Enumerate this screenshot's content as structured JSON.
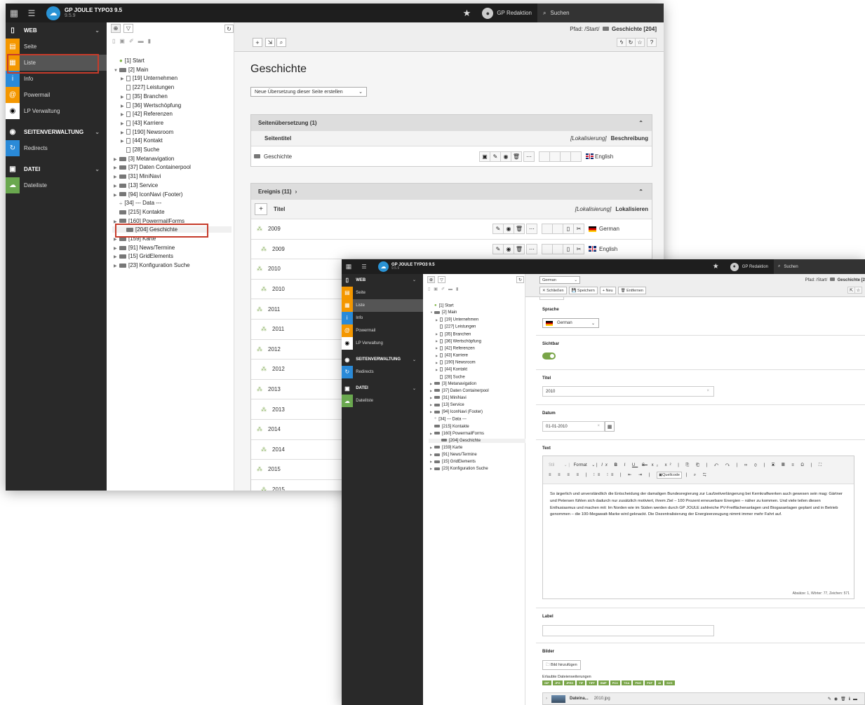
{
  "app": {
    "title": "GP JOULE TYPO3 9.5",
    "version": "9.5.9",
    "user": "GP Redaktion",
    "search": "Suchen"
  },
  "modules": [
    {
      "label": "WEB",
      "type": "group"
    },
    {
      "label": "Seite",
      "color": "#f49700"
    },
    {
      "label": "Liste",
      "color": "#f49700"
    },
    {
      "label": "Info",
      "color": "#2a8ad8"
    },
    {
      "label": "Powermail",
      "color": "#f49700"
    },
    {
      "label": "LP Verwaltung",
      "color": "#ffffff"
    },
    {
      "label": "SEITENVERWALTUNG",
      "type": "group"
    },
    {
      "label": "Redirects",
      "color": "#2a8ad8"
    },
    {
      "label": "DATEI",
      "type": "group"
    },
    {
      "label": "Dateiliste",
      "color": "#6aa84f"
    }
  ],
  "tree": [
    {
      "label": "[1] Start",
      "depth": 0
    },
    {
      "label": "[2] Main",
      "depth": 0
    },
    {
      "label": "[19] Unternehmen",
      "depth": 1
    },
    {
      "label": "[227] Leistungen",
      "depth": 1
    },
    {
      "label": "[35] Branchen",
      "depth": 1
    },
    {
      "label": "[36] Wertschöpfung",
      "depth": 1
    },
    {
      "label": "[42] Referenzen",
      "depth": 1
    },
    {
      "label": "[43] Karriere",
      "depth": 1
    },
    {
      "label": "[190] Newsroom",
      "depth": 1
    },
    {
      "label": "[44] Kontakt",
      "depth": 1
    },
    {
      "label": "[28] Suche",
      "depth": 1
    },
    {
      "label": "[3] Metanavigation",
      "depth": 0
    },
    {
      "label": "[37] Daten Containerpool",
      "depth": 0
    },
    {
      "label": "[31] MiniNavi",
      "depth": 0
    },
    {
      "label": "[13] Service",
      "depth": 0
    },
    {
      "label": "[94] IconNavi (Footer)",
      "depth": 0
    },
    {
      "label": "[34] --- Data ---",
      "depth": 0
    },
    {
      "label": "[215] Kontakte",
      "depth": 0
    },
    {
      "label": "[160] PowermailForms",
      "depth": 0
    },
    {
      "label": "[204] Geschichte",
      "depth": 0
    },
    {
      "label": "[159] Karte",
      "depth": 0
    },
    {
      "label": "[91] News/Termine",
      "depth": 0
    },
    {
      "label": "[15] GridElements",
      "depth": 0
    },
    {
      "label": "[23] Konfiguration Suche",
      "depth": 0
    }
  ],
  "list": {
    "path_label": "Pfad: /Start/",
    "path_page": "Geschichte [204]",
    "title": "Geschichte",
    "translate_select": "Neue Übersetzung dieser Seite erstellen",
    "translation_panel": "Seitenübersetzung (1)",
    "col_seitentitel": "Seitentitel",
    "col_lokalisierung": "[Lokalisierung]",
    "col_beschreibung": "Beschreibung",
    "translation_row": {
      "title": "Geschichte",
      "lang": "English"
    },
    "event_panel": "Ereignis (11)",
    "col_titel": "Titel",
    "col_lokalisieren": "Lokalisieren",
    "events": [
      {
        "year": "2009",
        "lang": "German",
        "sub": false
      },
      {
        "year": "2009",
        "lang": "English",
        "sub": true
      },
      {
        "year": "2010",
        "sub": false
      },
      {
        "year": "2010",
        "sub": true
      },
      {
        "year": "2011",
        "sub": false
      },
      {
        "year": "2011",
        "sub": true
      },
      {
        "year": "2012",
        "sub": false
      },
      {
        "year": "2012",
        "sub": true
      },
      {
        "year": "2013",
        "sub": false
      },
      {
        "year": "2013",
        "sub": true
      },
      {
        "year": "2014",
        "sub": false
      },
      {
        "year": "2014",
        "sub": true
      },
      {
        "year": "2015",
        "sub": false
      },
      {
        "year": "2015",
        "sub": true
      }
    ]
  },
  "editor": {
    "lang_select": "German",
    "btn_close": "Schließen",
    "btn_save": "Speichern",
    "btn_new": "Neu",
    "btn_delete": "Entfernen",
    "path_label": "Pfad: /Start/",
    "path_page": "Geschichte [2",
    "sprache_label": "Sprache",
    "sprache_value": "German",
    "sichtbar_label": "Sichtbar",
    "titel_label": "Titel",
    "titel_value": "2010",
    "datum_label": "Datum",
    "datum_value": "01-01-2010",
    "text_label": "Text",
    "rte_format": "Format",
    "rte_source": "Quellcode",
    "rte_text": "So ärgerlich und unverständlich die Entscheidung der damaligen Bundesregierung zur Laufzeitverlängerung bei Kernkraftwerken auch gewesen sein mag: Gärtner und Petersen fühlen sich dadurch nur zusätzlich motiviert, ihrem Ziel – 100 Prozent erneuerbare Energien – näher zu kommen. Und viele teilen diesen Enthusiasmus und machen mit: Im Norden wie im Süden werden durch GP JOULE zahlreiche PV-Freiflächenanlagen und Biogasanlagen geplant und in Betrieb genommen – die 100-Megawatt-Marke wird geknackt. Die Dezentralisierung der Energieerzeugung nimmt immer mehr Fahrt auf.",
    "rte_stats": "Absätze: 1, Wörter: 77, Zeichen: 571",
    "label_label": "Label",
    "bilder_label": "Bilder",
    "add_image": "Bild hinzufügen",
    "allowed_ext": "Erlaubte Dateierweiterungen",
    "extensions": [
      "GIF",
      "JPG",
      "JPEG",
      "TIF",
      "TIFF",
      "BMP",
      "PCX",
      "TGA",
      "PNG",
      "PDF",
      "AI",
      "SVG"
    ],
    "file_label": "Dateina...",
    "file_name": "2010.jpg"
  }
}
